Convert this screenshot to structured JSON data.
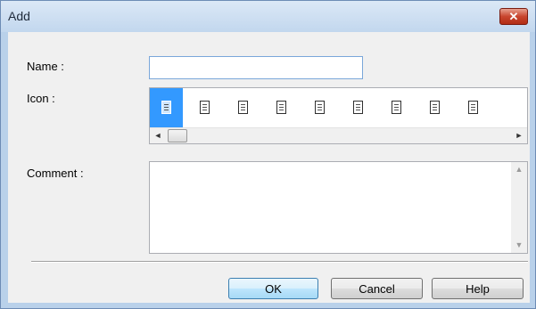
{
  "window": {
    "title": "Add",
    "close_glyph": "✕"
  },
  "form": {
    "name_label": "Name :",
    "name_value": "",
    "icon_label": "Icon :",
    "comment_label": "Comment :",
    "comment_value": ""
  },
  "icons": [
    {
      "name": "document-icon",
      "selected": true
    },
    {
      "name": "document-red-icon",
      "selected": false
    },
    {
      "name": "document-pen-icon",
      "selected": false
    },
    {
      "name": "image-document-icon",
      "selected": false
    },
    {
      "name": "document-lines-icon",
      "selected": false
    },
    {
      "name": "grid-document-icon",
      "selected": false
    },
    {
      "name": "document-edit-icon",
      "selected": false
    },
    {
      "name": "a4-document-icon",
      "selected": false
    },
    {
      "name": "calendar-document-icon",
      "selected": false
    }
  ],
  "buttons": {
    "ok": "OK",
    "cancel": "Cancel",
    "help": "Help"
  },
  "scroll_glyphs": {
    "left": "◄",
    "right": "►",
    "up": "▲",
    "down": "▼"
  }
}
